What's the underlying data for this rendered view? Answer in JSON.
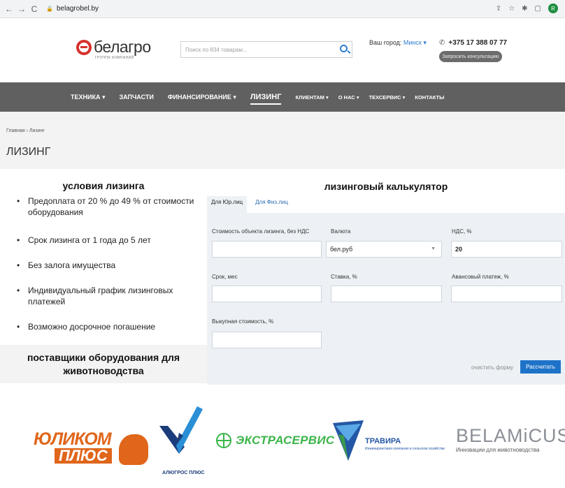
{
  "browser": {
    "url": "belagrobel.by",
    "back": "←",
    "forward": "→",
    "reload": "C",
    "profile_initial": "R"
  },
  "header": {
    "logo_text": "белагро",
    "logo_sub": "ГРУППА КОМПАНИЙ",
    "search_placeholder": "Поиск по 834 товарам...",
    "city_label": "Ваш город:",
    "city_value": "Минск ▾",
    "phone": "+375 17 388 07 77",
    "consult_button": "Запросить консультацию"
  },
  "nav": [
    {
      "label": "ТЕХНИКА ▾",
      "size": "normal"
    },
    {
      "label": "ЗАПЧАСТИ",
      "size": "normal"
    },
    {
      "label": "ФИНАНСИРОВАНИЕ ▾",
      "size": "normal"
    },
    {
      "label": "ЛИЗИНГ",
      "size": "active"
    },
    {
      "label": "КЛИЕНТАМ ▾",
      "size": "small"
    },
    {
      "label": "О НАС ▾",
      "size": "small"
    },
    {
      "label": "ТЕХСЕРВИС ▾",
      "size": "small"
    },
    {
      "label": "КОНТАКТЫ",
      "size": "small"
    }
  ],
  "title_band": {
    "breadcrumb": "Главная › Лизинг",
    "page_title": "ЛИЗИНГ"
  },
  "conditions": {
    "title": "условия лизинга",
    "items": [
      "Предоплата от 20 % до 49 % от стоимости оборудования",
      "Срок лизинга от 1 года до 5 лет",
      "Без залога имущества",
      "Индивидуальный график лизинговых платежей",
      "Возможно досрочное погашение"
    ]
  },
  "suppliers": {
    "title": "поставщики оборудования для животноводства"
  },
  "calculator": {
    "title": "лизинговый калькулятор",
    "tabs": [
      "Для Юр.лиц",
      "Для Физ.лиц"
    ],
    "fields": {
      "cost_label": "Стоимость объекта лизинга, без НДС",
      "cost_value": "",
      "currency_label": "Валюта",
      "currency_value": "бел.руб",
      "vat_label": "НДС, %",
      "vat_value": "20",
      "term_label": "Срок, мес",
      "term_value": "",
      "rate_label": "Ставка, %",
      "rate_value": "",
      "advance_label": "Авансовый платеж, %",
      "advance_value": "",
      "buyout_label": "Выкупная стоимость, %",
      "buyout_value": ""
    },
    "clear_link": "очистить форму",
    "calc_button": "Рассчитать"
  },
  "logos": {
    "yulikom_top": "ЮЛИКОМ",
    "yulikom_bottom": "ПЛЮС",
    "algros": "АЛЮГРОС ПЛЮС",
    "extra": "ЭКСТРАСЕРВИС",
    "travira_name": "ТРАВИРА",
    "travira_sub": "Инжиниринговая компания в сельском хозяйстве",
    "belamicus_name": "BELAMiCUS",
    "belamicus_sub": "Инновации для животноводства"
  }
}
